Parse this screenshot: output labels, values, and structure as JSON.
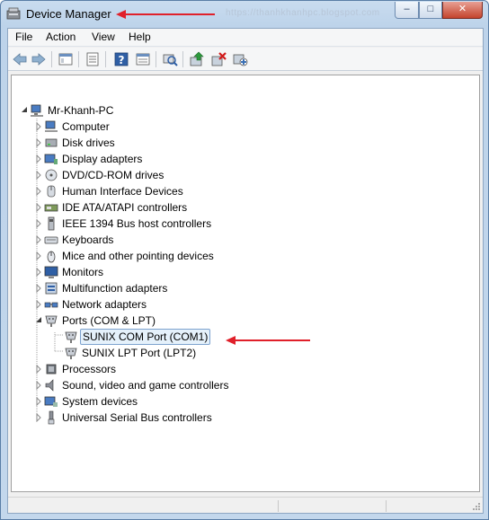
{
  "window": {
    "title": "Device Manager",
    "faint_text": "https://thanhkhanhpc.blogspot.com",
    "controls": {
      "minimize": "–",
      "maximize": "□",
      "close": "✕"
    }
  },
  "menu": [
    "File",
    "Action",
    "View",
    "Help"
  ],
  "toolbar": {
    "buttons": [
      "back-icon",
      "forward-icon",
      "show-hide-console-tree-icon",
      "properties-icon",
      "help-icon",
      "view-icon",
      "scan-hardware-icon",
      "update-driver-icon",
      "uninstall-icon",
      "disable-icon"
    ]
  },
  "tree": {
    "root": "Mr-Khanh-PC",
    "categories": [
      "Computer",
      "Disk drives",
      "Display adapters",
      "DVD/CD-ROM drives",
      "Human Interface Devices",
      "IDE ATA/ATAPI controllers",
      "IEEE 1394 Bus host controllers",
      "Keyboards",
      "Mice and other pointing devices",
      "Monitors",
      "Multifunction adapters",
      "Network adapters",
      "Ports (COM & LPT)",
      "Processors",
      "Sound, video and game controllers",
      "System devices",
      "Universal Serial Bus controllers"
    ],
    "ports_children": [
      "SUNIX COM Port (COM1)",
      "SUNIX LPT Port (LPT2)"
    ],
    "selected": "SUNIX COM Port (COM1)"
  },
  "colors": {
    "selection_bg": "#e5f1fb",
    "selection_border": "#7da2ce",
    "annotation_arrow": "#e0202a"
  }
}
